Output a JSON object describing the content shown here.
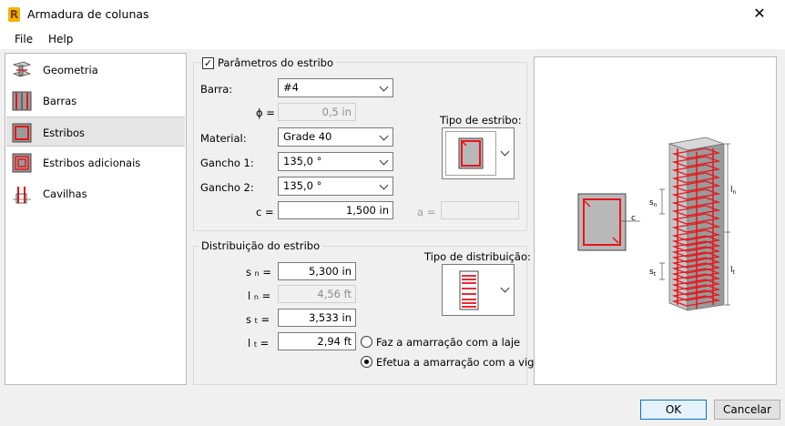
{
  "window": {
    "title": "Armadura de colunas",
    "app_icon": "R"
  },
  "menu": {
    "file": "File",
    "help": "Help"
  },
  "sidebar": {
    "items": [
      {
        "label": "Geometria",
        "icon": "geometry-icon"
      },
      {
        "label": "Barras",
        "icon": "bars-icon"
      },
      {
        "label": "Estribos",
        "icon": "stirrups-icon",
        "selected": true
      },
      {
        "label": "Estribos adicionais",
        "icon": "additional-stirrups-icon"
      },
      {
        "label": "Cavilhas",
        "icon": "dowels-icon"
      }
    ]
  },
  "stirrup_params": {
    "group_title": "Parâmetros do estribo",
    "checked": true,
    "barra_label": "Barra:",
    "barra_value": "#4",
    "phi_label": "ϕ =",
    "phi_value": "0,5 in",
    "material_label": "Material:",
    "material_value": "Grade 40",
    "gancho1_label": "Gancho 1:",
    "gancho1_value": "135,0 °",
    "gancho2_label": "Gancho 2:",
    "gancho2_value": "135,0 °",
    "c_label": "c =",
    "c_value": "1,500 in",
    "a_label": "a =",
    "a_value": "",
    "tipo_label": "Tipo de estribo:"
  },
  "distribution": {
    "group_title": "Distribuição do estribo",
    "sn_label": "s",
    "sn_sub": "n",
    "sn_value": "5,300 in",
    "ln_label": "l",
    "ln_sub": "n",
    "ln_value": "4,56 ft",
    "st_label": "s",
    "st_sub": "t",
    "st_value": "3,533 in",
    "lt_label": "l",
    "lt_sub": "t",
    "lt_value": "2,94 ft",
    "tipo_label": "Tipo de distribuição:",
    "radio1": "Faz a amarração com a laje",
    "radio2": "Efetua a amarração com a vigas",
    "selected_radio": 2
  },
  "preview": {
    "c_label": "c",
    "sn": "s",
    "sn_sub": "n",
    "ln": "l",
    "ln_sub": "n",
    "st": "s",
    "st_sub": "t",
    "lt": "l",
    "lt_sub": "t"
  },
  "buttons": {
    "ok": "OK",
    "cancel": "Cancelar"
  },
  "colors": {
    "rebar": "#e8141b",
    "concrete": "#b8b8b8",
    "accent": "#0078d7"
  }
}
